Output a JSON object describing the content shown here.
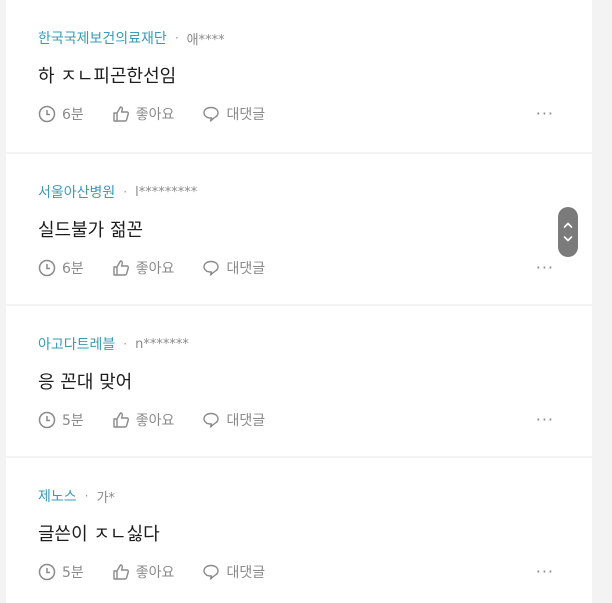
{
  "posts": [
    {
      "company": "한국국제보건의료재단",
      "user": "애****",
      "content": "하 ㅈㄴ피곤한선임",
      "time": "6분",
      "like_label": "좋아요",
      "reply_label": "대댓글",
      "more": "···"
    },
    {
      "company": "서울아산병원",
      "user": "l*********",
      "content": "실드불가 젊꼰",
      "time": "6분",
      "like_label": "좋아요",
      "reply_label": "대댓글",
      "more": "···"
    },
    {
      "company": "아고다트레블",
      "user": "n*******",
      "content": "응 꼰대 맞어",
      "time": "5분",
      "like_label": "좋아요",
      "reply_label": "대댓글",
      "more": "···"
    },
    {
      "company": "제노스",
      "user": "가*",
      "content": "글쓴이 ㅈㄴ싫다",
      "time": "5분",
      "like_label": "좋아요",
      "reply_label": "대댓글",
      "more": "···"
    }
  ],
  "separator": "·",
  "colors": {
    "company": "#3a9bb6",
    "muted": "#8a8a8a",
    "text": "#1d1d1d",
    "divider": "#f3f3f3"
  },
  "icons": [
    "clock-icon",
    "thumbs-up-icon",
    "comment-icon",
    "chevron-up-icon",
    "chevron-down-icon"
  ]
}
